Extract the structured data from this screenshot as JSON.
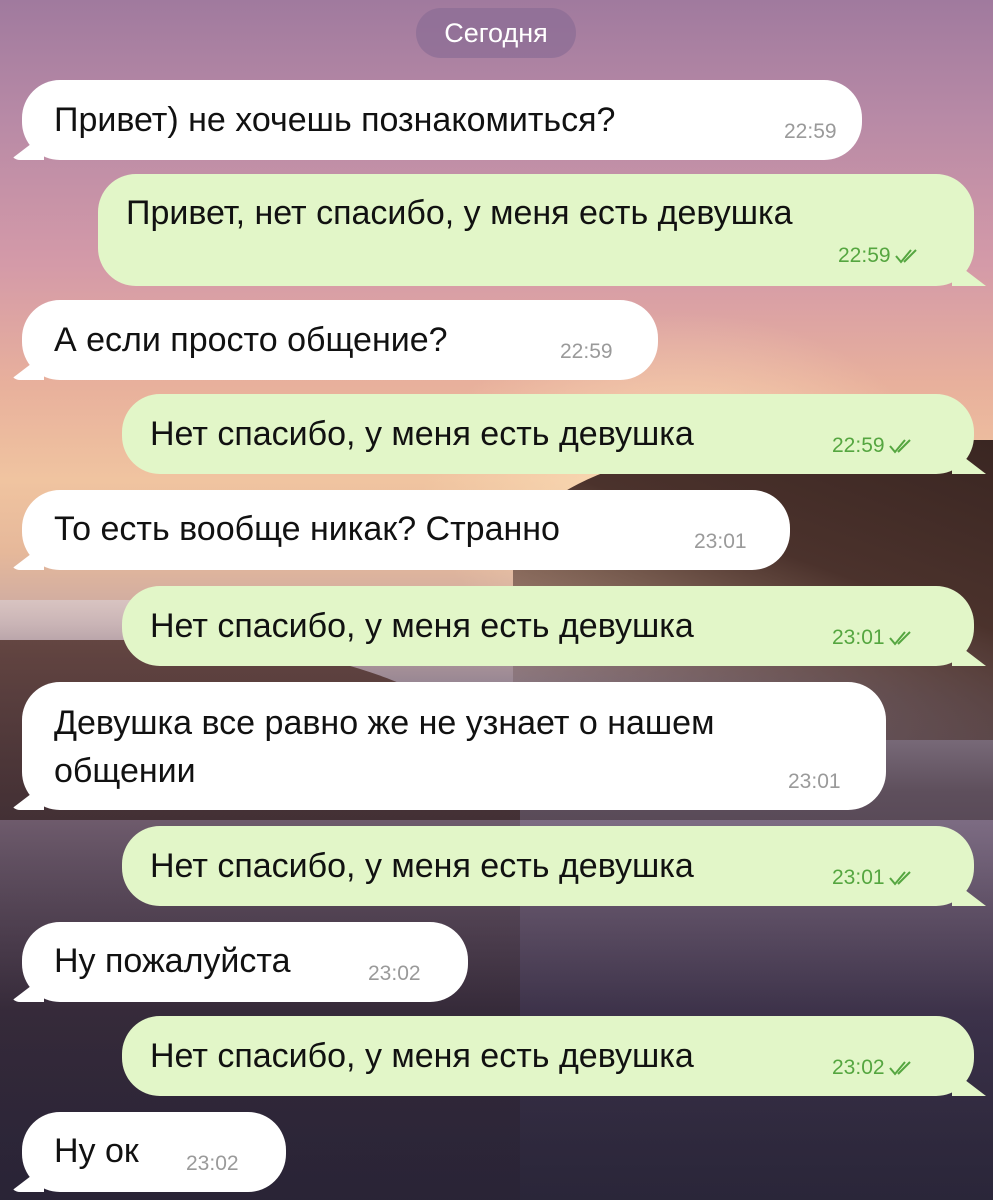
{
  "date_label": "Сегодня",
  "colors": {
    "incoming_bubble": "#ffffff",
    "outgoing_bubble": "#e2f6c8",
    "outgoing_time": "#55a640",
    "incoming_time": "#9a9a9a"
  },
  "messages": [
    {
      "direction": "in",
      "text": "Привет) не хочешь познакомиться?",
      "time": "22:59"
    },
    {
      "direction": "out",
      "text": "Привет, нет спасибо, у меня есть девушка",
      "time": "22:59",
      "status": "read"
    },
    {
      "direction": "in",
      "text": "А если просто общение?",
      "time": "22:59"
    },
    {
      "direction": "out",
      "text": "Нет спасибо, у меня есть девушка",
      "time": "22:59",
      "status": "read"
    },
    {
      "direction": "in",
      "text": "То есть вообще никак? Странно",
      "time": "23:01"
    },
    {
      "direction": "out",
      "text": "Нет спасибо, у меня есть девушка",
      "time": "23:01",
      "status": "read"
    },
    {
      "direction": "in",
      "text_line1": "Девушка все равно же не узнает о нашем",
      "text_line2": "общении",
      "time": "23:01"
    },
    {
      "direction": "out",
      "text": "Нет спасибо, у меня есть девушка",
      "time": "23:01",
      "status": "read"
    },
    {
      "direction": "in",
      "text": "Ну пожалуйста",
      "time": "23:02"
    },
    {
      "direction": "out",
      "text": "Нет спасибо, у меня есть девушка",
      "time": "23:02",
      "status": "read"
    },
    {
      "direction": "in",
      "text": "Ну ок",
      "time": "23:02"
    }
  ]
}
